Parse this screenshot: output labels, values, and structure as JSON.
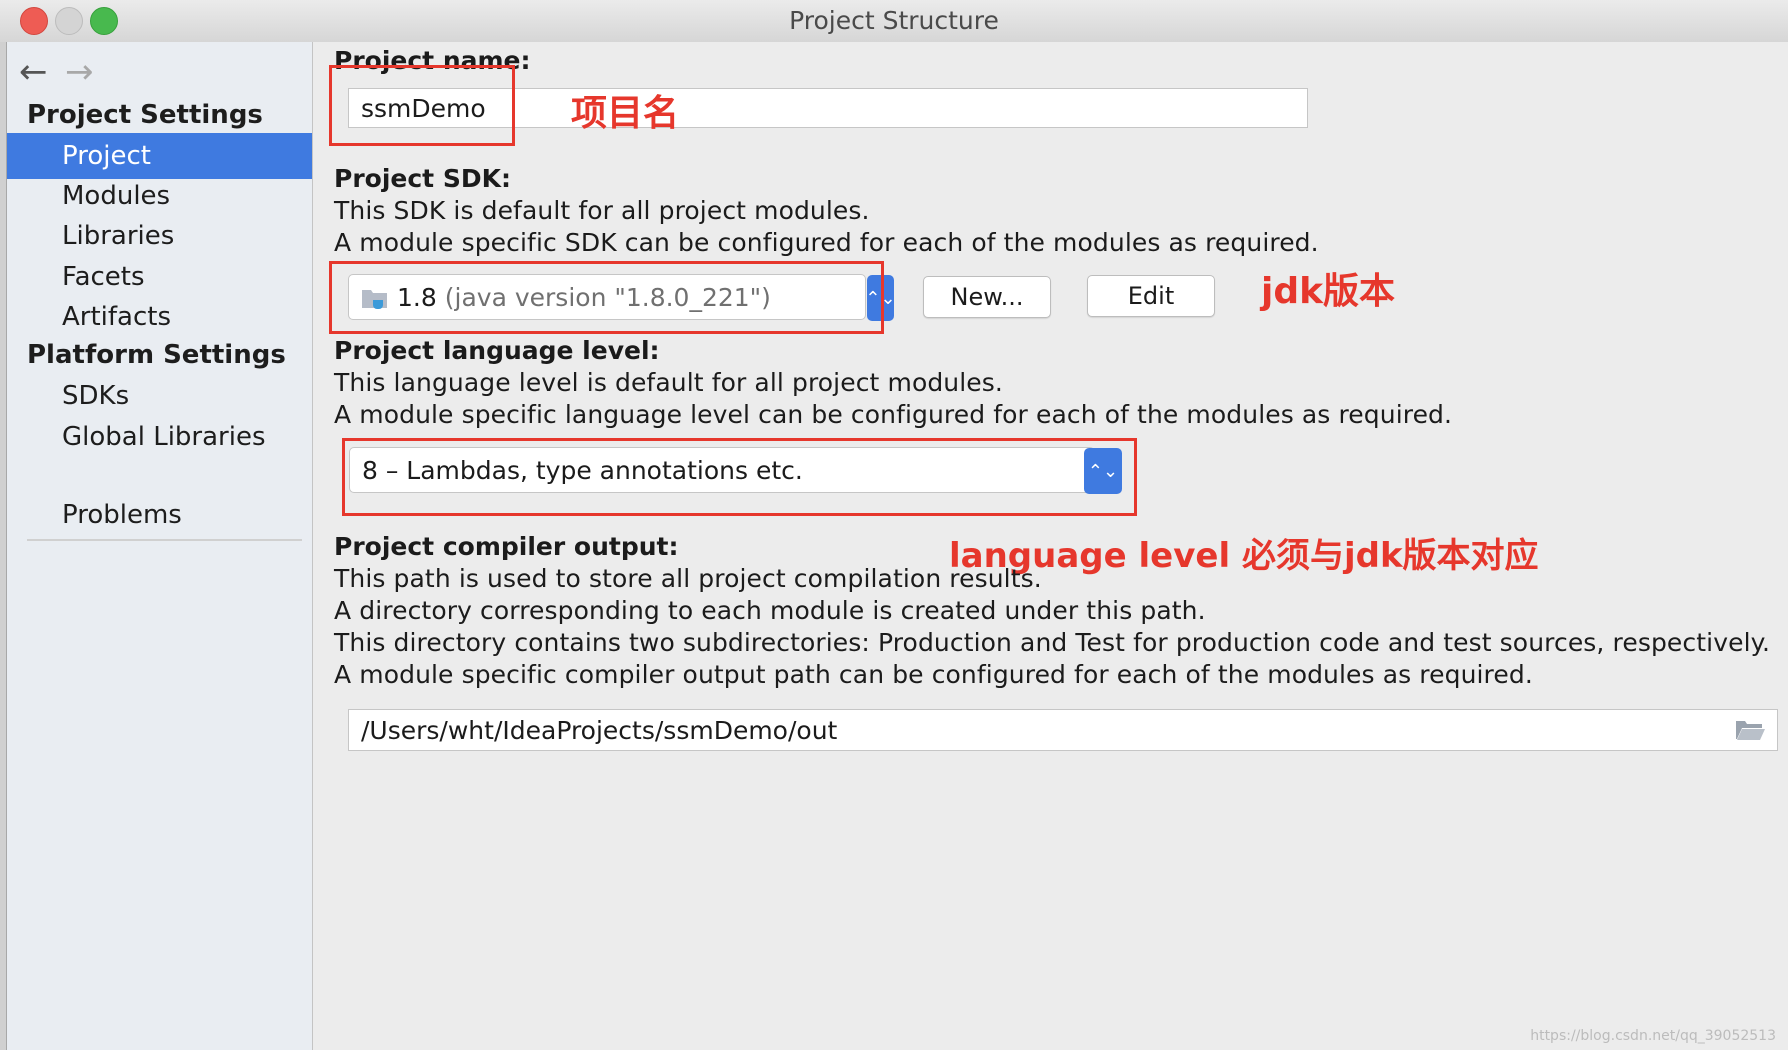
{
  "window": {
    "title": "Project Structure",
    "traffic_lights": {
      "close": "#ee5c54",
      "minimize": "#d4d4d4",
      "maximize": "#48b94e"
    }
  },
  "sidebar": {
    "back_icon": "←",
    "forward_icon": "→",
    "project_settings_label": "Project Settings",
    "project_items": [
      "Project",
      "Modules",
      "Libraries",
      "Facets",
      "Artifacts"
    ],
    "platform_settings_label": "Platform Settings",
    "platform_items": [
      "SDKs",
      "Global Libraries"
    ],
    "problems_label": "Problems",
    "selected_item": "Project",
    "accent_color": "#3f7ae0"
  },
  "main": {
    "project_name": {
      "label": "Project name:",
      "value": "ssmDemo"
    },
    "project_sdk": {
      "label": "Project SDK:",
      "desc_1": "This SDK is default for all project modules.",
      "desc_2": "A module specific SDK can be configured for each of the modules as required.",
      "selected_version": "1.8",
      "selected_detail": "(java version \"1.8.0_221\")",
      "new_button": "New...",
      "edit_button": "Edit"
    },
    "language_level": {
      "label": "Project language level:",
      "desc_1": "This language level is default for all project modules.",
      "desc_2": "A module specific language level can be configured for each of the modules as required.",
      "selected": "8 – Lambdas, type annotations etc."
    },
    "compiler_output": {
      "label": "Project compiler output:",
      "desc_1": "This path is used to store all project compilation results.",
      "desc_2": "A directory corresponding to each module is created under this path.",
      "desc_3": "This directory contains two subdirectories: Production and Test for production code and test sources, respectively.",
      "desc_4": "A module specific compiler output path can be configured for each of the modules as required.",
      "path": "/Users/wht/IdeaProjects/ssmDemo/out"
    }
  },
  "annotations": {
    "project_name_note": "项目名",
    "jdk_note": "jdk版本",
    "language_note": "language level 必须与jdk版本对应",
    "color": "#e6372c"
  },
  "watermark": "https://blog.csdn.net/qq_39052513"
}
